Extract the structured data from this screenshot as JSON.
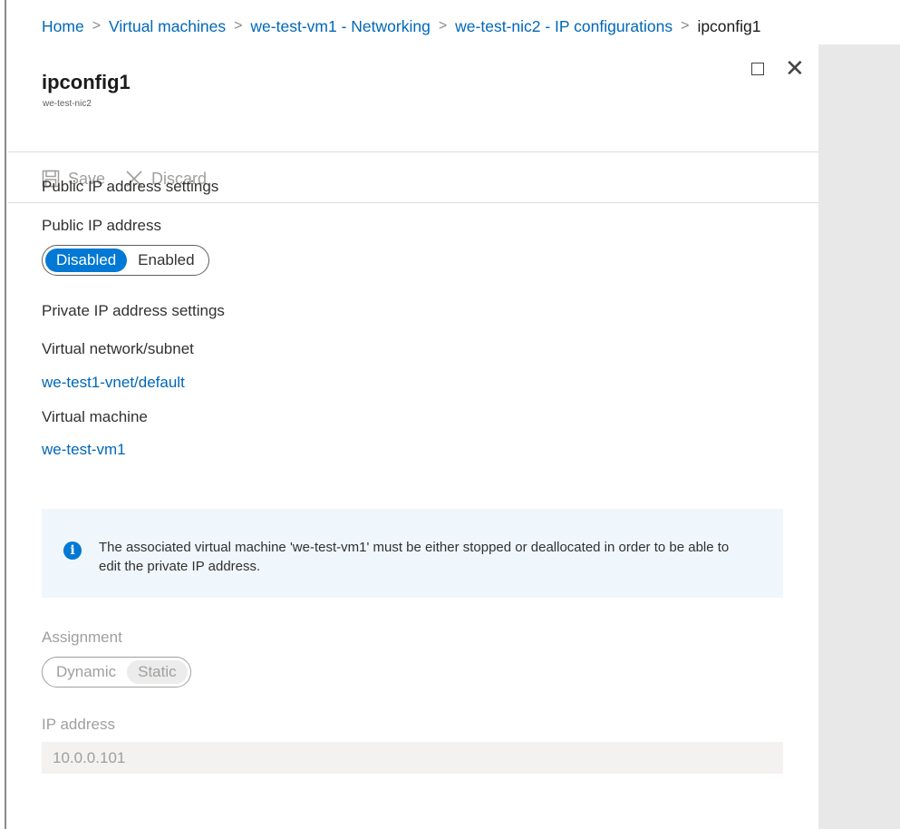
{
  "breadcrumb": {
    "items": [
      "Home",
      "Virtual machines",
      "we-test-vm1 - Networking",
      "we-test-nic2 - IP configurations"
    ],
    "current": "ipconfig1"
  },
  "blade": {
    "title": "ipconfig1",
    "subtitle": "we-test-nic2"
  },
  "toolbar": {
    "save_label": "Save",
    "discard_label": "Discard"
  },
  "public_ip": {
    "section_title": "Public IP address settings",
    "field_label": "Public IP address",
    "options": [
      "Disabled",
      "Enabled"
    ],
    "selected": "Disabled"
  },
  "private_ip": {
    "section_title": "Private IP address settings",
    "vnet_label": "Virtual network/subnet",
    "vnet_value": "we-test1-vnet/default",
    "vm_label": "Virtual machine",
    "vm_value": "we-test-vm1",
    "info_message": "The associated virtual machine 'we-test-vm1' must be either stopped or deallocated in order to be able to edit the private IP address.",
    "assignment_label": "Assignment",
    "assignment_options": [
      "Dynamic",
      "Static"
    ],
    "assignment_selected": "Static",
    "ip_label": "IP address",
    "ip_value": "10.0.0.101"
  },
  "colors": {
    "accent": "#0078d4",
    "link": "#0067b8",
    "info_bg": "#eff6fc",
    "side_panel": "#e8e8e8"
  }
}
